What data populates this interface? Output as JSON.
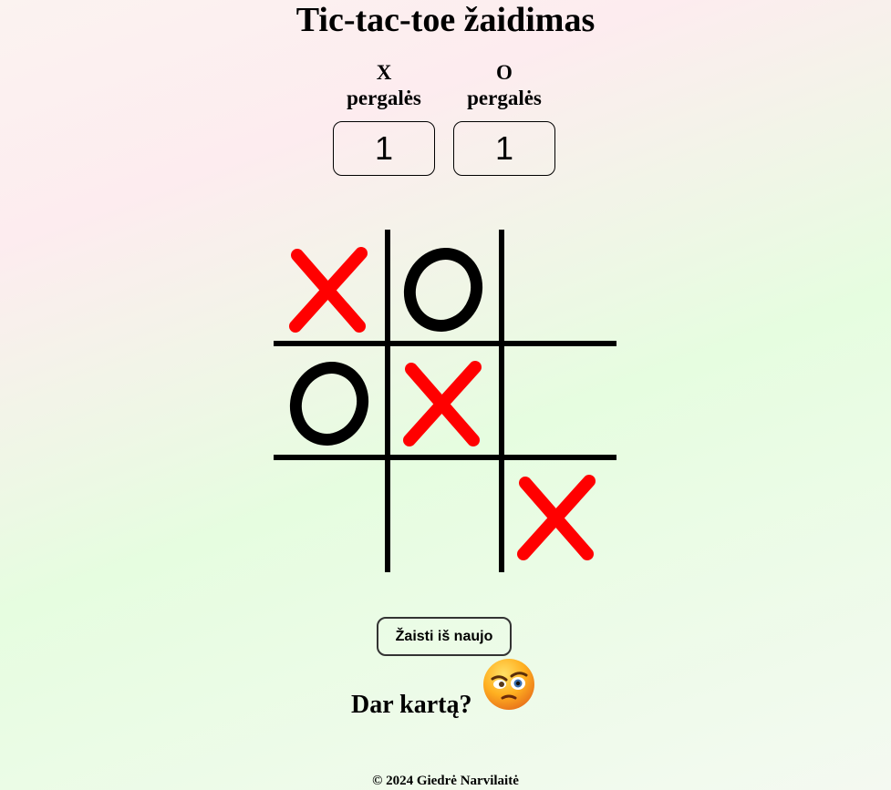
{
  "title": "Tic-tac-toe žaidimas",
  "scores": {
    "x": {
      "label_line1": "X",
      "label_line2": "pergalės",
      "value": "1"
    },
    "o": {
      "label_line1": "O",
      "label_line2": "pergalės",
      "value": "1"
    }
  },
  "board": {
    "cells": [
      "X",
      "O",
      "",
      "O",
      "X",
      "",
      "",
      "",
      "X"
    ],
    "x_color": "#ff0000",
    "o_color": "#000000"
  },
  "restart_button": "Žaisti iš naujo",
  "prompt": "Dar kartą?",
  "emoji": "angry-face-icon",
  "footer": "© 2024 Giedrė Narvilaitė"
}
